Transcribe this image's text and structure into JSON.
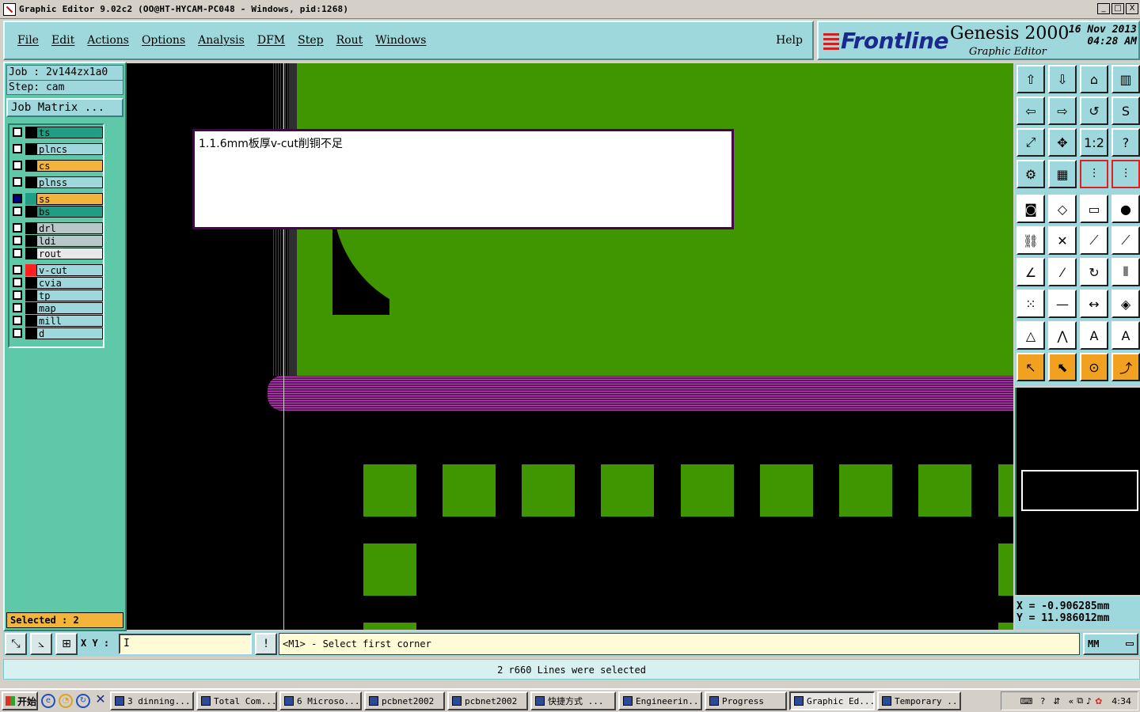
{
  "window": {
    "title": "Graphic Editor 9.02c2  (OO@HT-HYCAM-PC048 - Windows, pid:1268)",
    "minimize": "_",
    "maximize": "□",
    "close": "X"
  },
  "menu": {
    "items": [
      "File",
      "Edit",
      "Actions",
      "Options",
      "Analysis",
      "DFM",
      "Step",
      "Rout",
      "Windows"
    ],
    "help": "Help"
  },
  "brand": {
    "logo": "Frontline",
    "product": "Genesis 2000",
    "subtitle": "Graphic Editor",
    "date": "16 Nov 2013",
    "time": "04:28 AM"
  },
  "job": {
    "job_label": "Job : 2v144zx1a0",
    "step_label": "Step: cam",
    "matrix_button": "Job Matrix ..."
  },
  "layers": [
    {
      "name": "ts",
      "color": "#1f9e84",
      "swatch": "#000000",
      "checked": false
    },
    {
      "name": "plncs",
      "color": "#9ed8dc",
      "swatch": "#000000",
      "checked": false
    },
    {
      "name": "cs",
      "color": "#f2b43a",
      "swatch": "#000000",
      "checked": false
    },
    {
      "name": "plnss",
      "color": "#9ed8dc",
      "swatch": "#000000",
      "checked": false
    },
    {
      "name": "ss",
      "color": "#f2b43a",
      "swatch": "#1f9e84",
      "checked": true
    },
    {
      "name": "bs",
      "color": "#1f9e84",
      "swatch": "#000000",
      "checked": false
    },
    {
      "name": "drl",
      "color": "#b8c8c8",
      "swatch": "#000000",
      "checked": false
    },
    {
      "name": "ldi",
      "color": "#b8c8c8",
      "swatch": "#000000",
      "checked": false
    },
    {
      "name": "rout",
      "color": "#e8e8e8",
      "swatch": "#000000",
      "checked": false
    },
    {
      "name": "v-cut",
      "color": "#9ed8dc",
      "swatch": "#ff2020",
      "checked": false
    },
    {
      "name": "cvia",
      "color": "#9ed8dc",
      "swatch": "#000000",
      "checked": false
    },
    {
      "name": "tp",
      "color": "#9ed8dc",
      "swatch": "#000000",
      "checked": false
    },
    {
      "name": "map",
      "color": "#9ed8dc",
      "swatch": "#000000",
      "checked": false
    },
    {
      "name": "mill",
      "color": "#9ed8dc",
      "swatch": "#000000",
      "checked": false
    },
    {
      "name": "d",
      "color": "#9ed8dc",
      "swatch": "#000000",
      "checked": false
    }
  ],
  "selected_label": "Selected : 2",
  "note_text": "1.1.6mm板厚v-cut削铜不足",
  "tool_labels": {
    "ratio": "1:2",
    "help": "?"
  },
  "coords": {
    "x": "X = -0.906285mm",
    "y": "Y = 11.986012mm"
  },
  "command": {
    "xy_label": "X Y :",
    "xy_value": "I",
    "bang": "!",
    "prompt": "<M1> - Select first corner",
    "unit": "MM"
  },
  "status_text": "2 r660 Lines were selected",
  "taskbar": {
    "start": "开始",
    "tasks": [
      {
        "label": "3 dinning...",
        "active": false
      },
      {
        "label": "Total Com...",
        "active": false
      },
      {
        "label": "6 Microso...",
        "active": false
      },
      {
        "label": "pcbnet2002",
        "active": false
      },
      {
        "label": "pcbnet2002",
        "active": false
      },
      {
        "label": "快捷方式 ...",
        "active": false
      },
      {
        "label": "Engineerin...",
        "active": false
      },
      {
        "label": "Progress",
        "active": false
      },
      {
        "label": "Graphic Ed...",
        "active": true
      },
      {
        "label": "Temporary ...",
        "active": false
      }
    ],
    "clock": "4:34"
  }
}
